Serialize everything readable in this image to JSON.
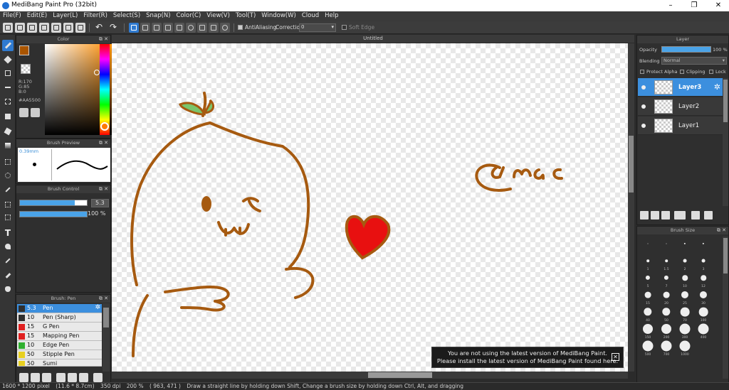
{
  "window": {
    "title": "MediBang Paint Pro (32bit)",
    "minimize": "–",
    "maximize": "❐",
    "close": "✕"
  },
  "menu": [
    "File(F)",
    "Edit(E)",
    "Layer(L)",
    "Filter(R)",
    "Select(S)",
    "Snap(N)",
    "Color(C)",
    "View(V)",
    "Tool(T)",
    "Window(W)",
    "Cloud",
    "Help"
  ],
  "toolbar": {
    "antialiasing_label": "AntiAliasing",
    "correction_label": "Correction",
    "correction_value": "0",
    "soft_edge_label": "Soft Edge"
  },
  "color_panel": {
    "title": "Color",
    "fg": "#aa5500",
    "bg": "#e81010",
    "r": "R:170",
    "g": "G:85",
    "b": "B:0",
    "hex": "#AA5500"
  },
  "brush_preview": {
    "title": "Brush Preview",
    "size": "0.39mm"
  },
  "brush_control": {
    "title": "Brush Control",
    "size_value": "5.3",
    "size_fraction": 0.82,
    "opacity_value": "100 %",
    "opacity_fraction": 1.0
  },
  "brush_list": {
    "title": "Brush: Pen",
    "items": [
      {
        "num": "5.3",
        "name": "Pen",
        "color": "#2f2f2f",
        "active": true
      },
      {
        "num": "10",
        "name": "Pen (Sharp)",
        "color": "#2f2f2f"
      },
      {
        "num": "15",
        "name": "G Pen",
        "color": "#e02020"
      },
      {
        "num": "15",
        "name": "Mapping Pen",
        "color": "#e02020"
      },
      {
        "num": "10",
        "name": "Edge Pen",
        "color": "#30b030"
      },
      {
        "num": "50",
        "name": "Stipple Pen",
        "color": "#e8d020"
      },
      {
        "num": "50",
        "name": "Sumi",
        "color": "#e8d020"
      }
    ]
  },
  "canvas": {
    "tab_title": "Untitled",
    "drawn_text": "@mac"
  },
  "toast": {
    "line1": "You are not using the latest version of MediBang Paint.",
    "line2": "Please install the latest version of MediBang Paint found here.",
    "close": "✕"
  },
  "layer_panel": {
    "title": "Layer",
    "opacity_label": "Opacity",
    "opacity_value": "100 %",
    "opacity_fraction": 1.0,
    "blending_label": "Blending",
    "blending_value": "Normal",
    "protect_alpha": "Protect Alpha",
    "clipping": "Clipping",
    "lock": "Lock",
    "layers": [
      {
        "name": "Layer3",
        "active": true
      },
      {
        "name": "Layer2",
        "active": false
      },
      {
        "name": "Layer1",
        "active": false
      }
    ]
  },
  "brush_size": {
    "title": "Brush Size",
    "sizes": [
      "",
      "",
      "",
      "",
      "1",
      "1.5",
      "2",
      "3",
      "5",
      "7",
      "10",
      "12",
      "15",
      "20",
      "25",
      "30",
      "40",
      "50",
      "70",
      "100",
      "150",
      "200",
      "300",
      "400",
      "500",
      "700",
      "1000"
    ]
  },
  "status": {
    "pixels": "1600 * 1200 pixel",
    "cm": "(11.6 * 8.7cm)",
    "dpi": "350 dpi",
    "zoom": "200 %",
    "coords": "( 963, 471 )",
    "hint": "Draw a straight line by holding down Shift, Change a brush size by holding down Ctrl, Alt, and dragging"
  }
}
